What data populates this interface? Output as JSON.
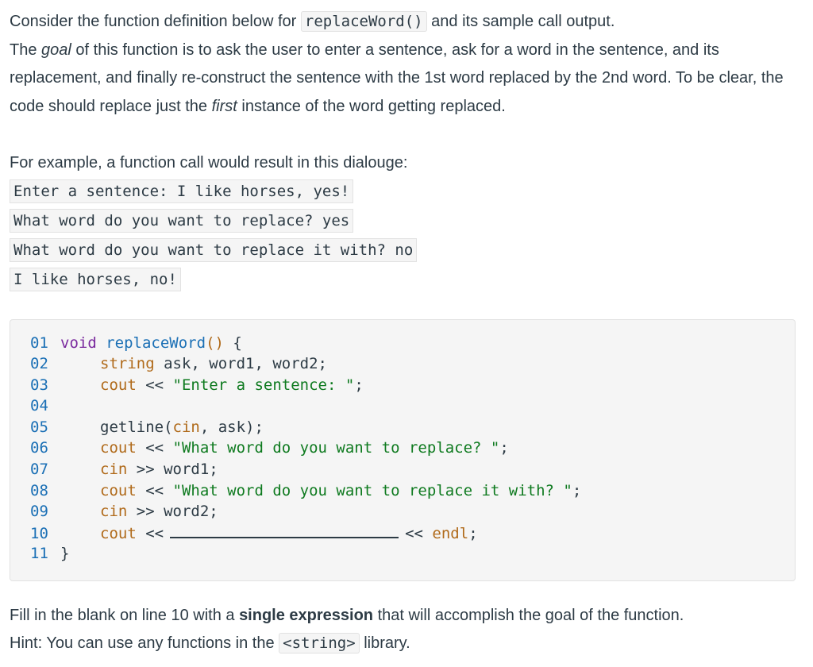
{
  "intro": {
    "line1_pre": "Consider the function definition below for ",
    "line1_code": "replaceWord()",
    "line1_post": " and its sample call output.",
    "goal_pre": "The ",
    "goal_em": "goal",
    "goal_post": " of this function is to ask the user to enter a sentence, ask for a word in the sentence, and its replacement, and finally re-construct the sentence with the 1st word replaced by the 2nd word. To be clear, the code should replace just the ",
    "first_em": "first",
    "goal_end": " instance of the word getting replaced."
  },
  "example": {
    "label": "For example, a function call would result in this dialouge:",
    "lines": [
      "Enter a sentence: I like horses, yes!",
      "What word do you want to replace? yes",
      "What word do you want to replace it with? no",
      "I like horses, no!"
    ]
  },
  "code": {
    "line_numbers": [
      "01",
      "02",
      "03",
      "04",
      "05",
      "06",
      "07",
      "08",
      "09",
      "10",
      "11"
    ],
    "l1_kw": "void",
    "l1_fn": "replaceWord",
    "l1_paren": "()",
    "l1_brace": " {",
    "l2_type": "string",
    "l2_rest": " ask, word1, word2;",
    "l3_cout": "cout",
    "l3_op": " << ",
    "l3_str": "\"Enter a sentence: \"",
    "l3_end": ";",
    "l5_fn": "getline(",
    "l5_cin": "cin",
    "l5_rest": ", ask);",
    "l6_cout": "cout",
    "l6_op": " << ",
    "l6_str": "\"What word do you want to replace? \"",
    "l6_end": ";",
    "l7_cin": "cin",
    "l7_rest": " >> word1;",
    "l8_cout": "cout",
    "l8_op": " << ",
    "l8_str": "\"What word do you want to replace it with? \"",
    "l8_end": ";",
    "l9_cin": "cin",
    "l9_rest": " >> word2;",
    "l10_cout": "cout",
    "l10_op": " <<",
    "l10_op2": "<< ",
    "l10_endl": "endl",
    "l10_end": ";",
    "l11": "}"
  },
  "footer": {
    "line1_pre": "Fill in the blank on line 10 with a ",
    "line1_bold": "single expression",
    "line1_post": " that will accomplish the goal of the function.",
    "line2_pre": "Hint: You can use any functions in the ",
    "line2_code": "<string>",
    "line2_post": " library."
  }
}
